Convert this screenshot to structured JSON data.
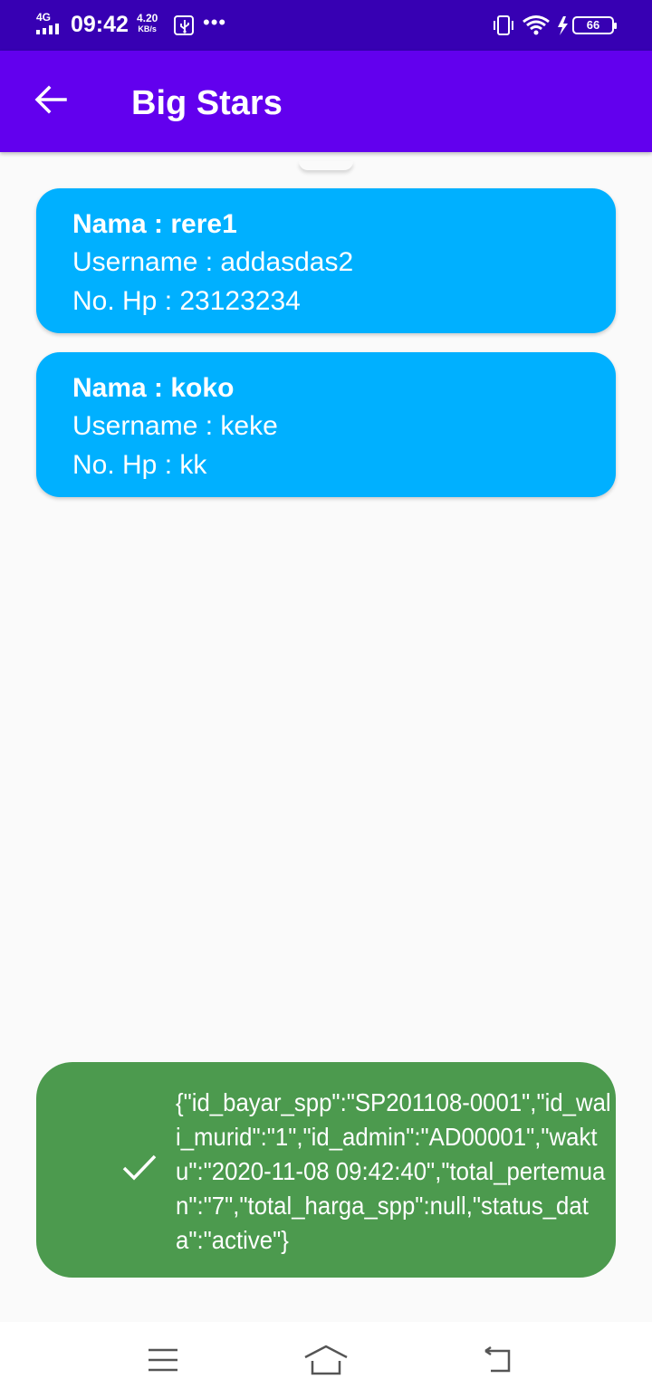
{
  "status_bar": {
    "network": "4G",
    "time": "09:42",
    "speed_value": "4.20",
    "speed_unit": "KB/s",
    "more": "•••",
    "battery": "66"
  },
  "app_bar": {
    "title": "Big Stars"
  },
  "students": [
    {
      "name": "Nama : rere1",
      "username": "Username : addasdas2",
      "phone": "No. Hp : 23123234"
    },
    {
      "name": "Nama : koko",
      "username": "Username : keke",
      "phone": "No. Hp : kk"
    }
  ],
  "toast": {
    "message": "{\"id_bayar_spp\":\"SP201108-0001\",\"id_wali_murid\":\"1\",\"id_admin\":\"AD00001\",\"waktu\":\"2020-11-08 09:42:40\",\"total_pertemuan\":\"7\",\"total_harga_spp\":null,\"status_data\":\"active\"}"
  },
  "colors": {
    "status_bar": "#3700b3",
    "app_bar": "#6200ee",
    "card": "#00b0ff",
    "toast": "#4c9a4e"
  }
}
